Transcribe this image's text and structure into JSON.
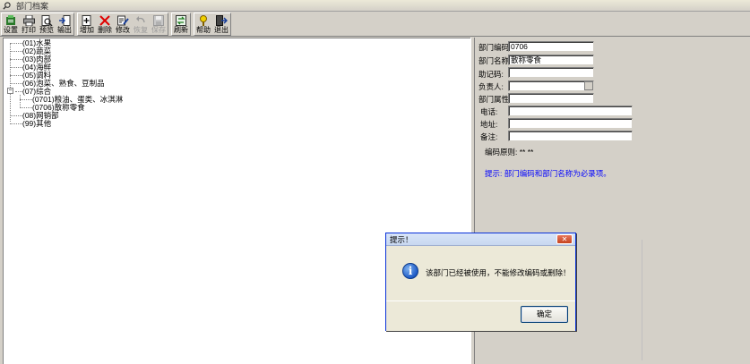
{
  "window": {
    "title": "部门档案",
    "title_icon": "search-icon"
  },
  "toolbar": {
    "buttons": [
      {
        "label": "设置",
        "icon": "settings-icon"
      },
      {
        "label": "打印",
        "icon": "print-icon"
      },
      {
        "label": "预览",
        "icon": "preview-icon"
      },
      {
        "label": "输出",
        "icon": "export-icon"
      },
      {
        "label": "增加",
        "icon": "add-icon"
      },
      {
        "label": "删除",
        "icon": "delete-icon"
      },
      {
        "label": "修改",
        "icon": "edit-icon"
      },
      {
        "label": "恢复",
        "icon": "undo-icon",
        "disabled": true
      },
      {
        "label": "保存",
        "icon": "save-icon",
        "disabled": true
      },
      {
        "label": "刷新",
        "icon": "refresh-icon"
      },
      {
        "label": "帮助",
        "icon": "help-icon"
      },
      {
        "label": "退出",
        "icon": "exit-icon"
      }
    ]
  },
  "tree": {
    "items": [
      {
        "label": "(01)水果"
      },
      {
        "label": "(02)蔬菜"
      },
      {
        "label": "(03)肉部"
      },
      {
        "label": "(04)海鲜"
      },
      {
        "label": "(05)调料"
      },
      {
        "label": "(06)泡菜、熟食、豆制品"
      },
      {
        "label": "(07)综合",
        "expanded": true
      },
      {
        "label": "(0701)粮油、蛋类、冰淇淋"
      },
      {
        "label": "(0706)散称零食",
        "selected": true
      },
      {
        "label": "(08)网销部"
      },
      {
        "label": "(99)其他"
      }
    ]
  },
  "form": {
    "code_label": "部门编码",
    "code_value": "0706",
    "name_label": "部门名称",
    "name_value": "散称零食",
    "mnemonic_label": "助记码:",
    "mnemonic_value": "",
    "manager_label": "负责人:",
    "manager_value": "",
    "attr_label": "部门属性:",
    "attr_value": "",
    "phone_label": "电话:",
    "phone_value": "",
    "address_label": "地址:",
    "address_value": "",
    "note_label": "备注:",
    "note_value": "",
    "rule_text": "编码原则: ** **",
    "hint_text": "提示: 部门编码和部门名称为必录项。"
  },
  "dialog": {
    "title": "提示！",
    "close_glyph": "✕",
    "icon": "info-icon",
    "icon_glyph": "i",
    "message": "该部门已经被使用，不能修改编码或删除！",
    "ok_label": "确定"
  },
  "colors": {
    "hint": "#0000ff",
    "dialog_border": "#0831d9",
    "close_button": "#c5431f"
  }
}
